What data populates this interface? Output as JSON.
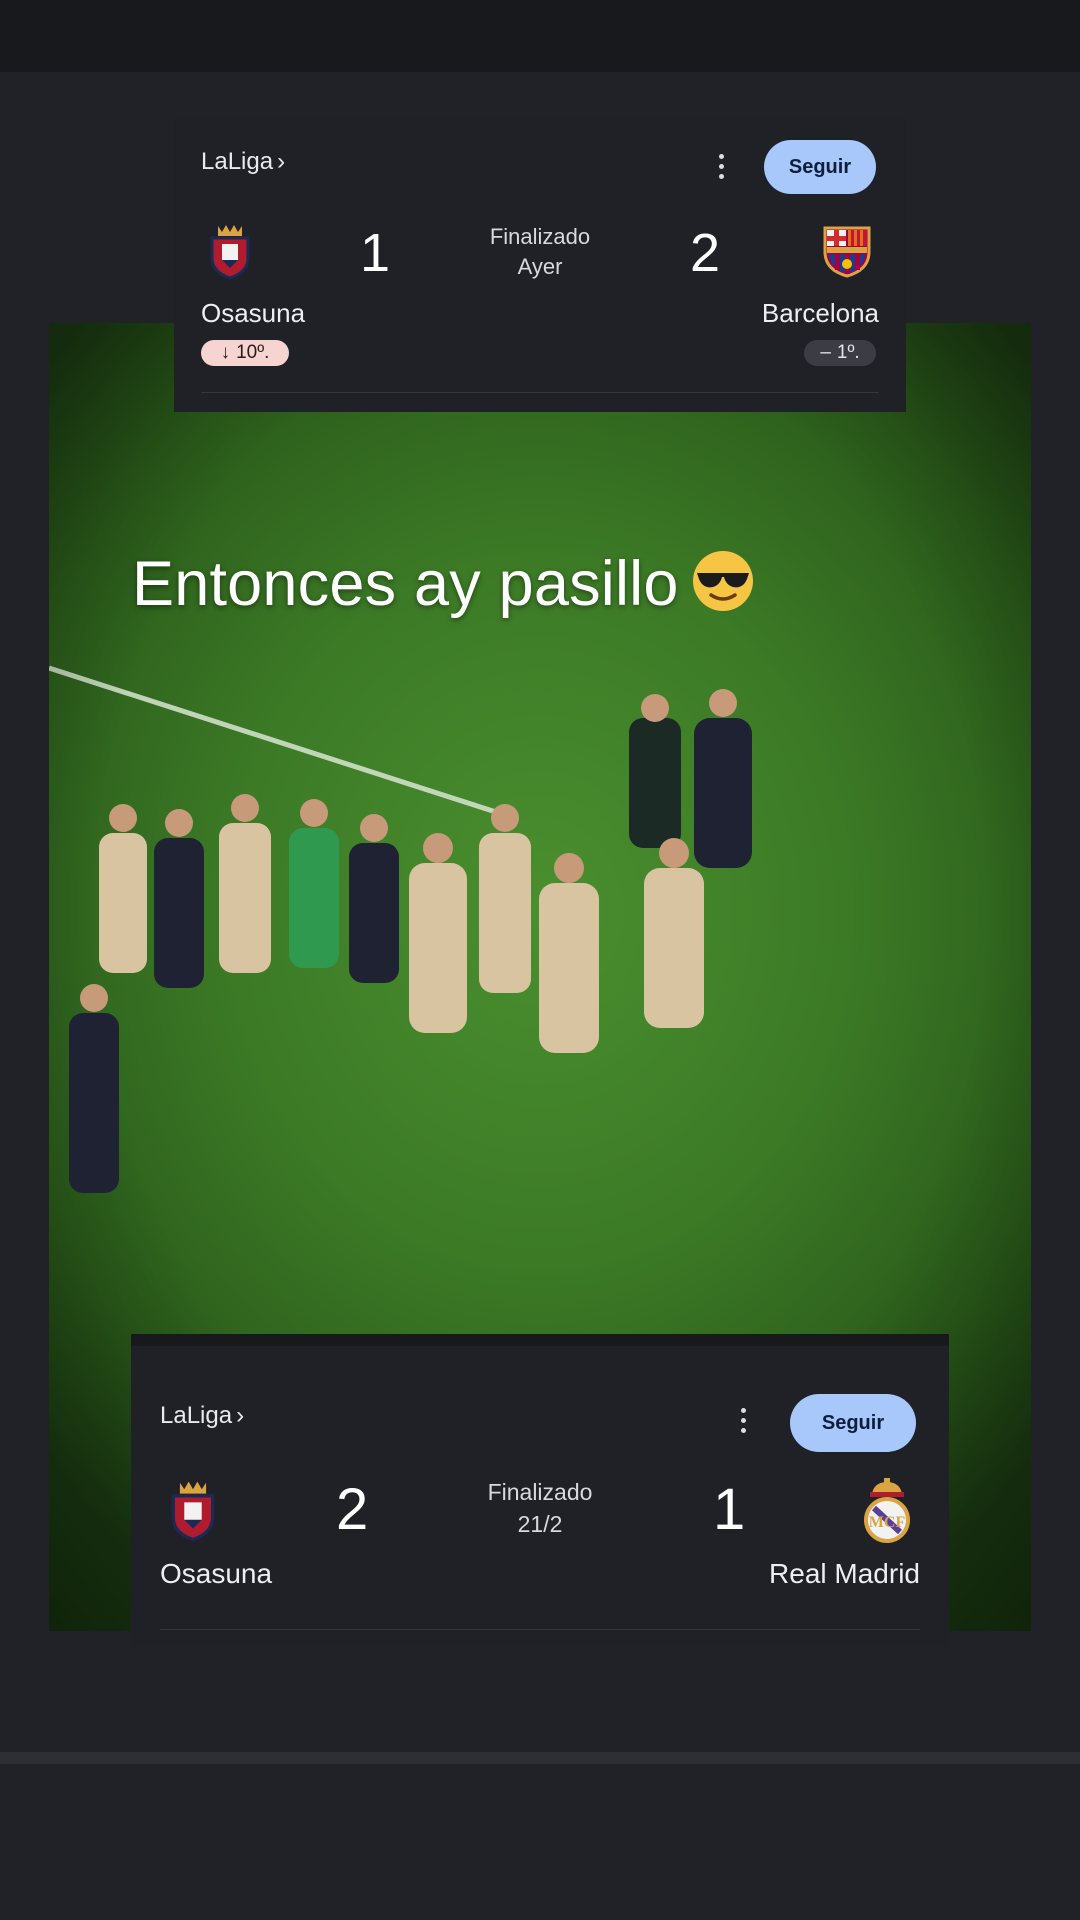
{
  "caption": {
    "text": "Entonces ay pasillo",
    "emoji": "sunglasses-emoji"
  },
  "match_top": {
    "league_label": "LaLiga",
    "league_chevron": "›",
    "follow_label": "Seguir",
    "status_line1": "Finalizado",
    "status_line2": "Ayer",
    "home": {
      "name": "Osasuna",
      "score": "1",
      "rank_label": "10º.",
      "rank_trend_icon": "↓",
      "crest": "osasuna-crest"
    },
    "away": {
      "name": "Barcelona",
      "score": "2",
      "rank_label": "1º.",
      "rank_trend_icon": "–",
      "crest": "barcelona-crest"
    }
  },
  "match_bottom": {
    "league_label": "LaLiga",
    "league_chevron": "›",
    "follow_label": "Seguir",
    "status_line1": "Finalizado",
    "status_line2": "21/2",
    "home": {
      "name": "Osasuna",
      "score": "2",
      "crest": "osasuna-crest"
    },
    "away": {
      "name": "Real Madrid",
      "score": "1",
      "crest": "real-madrid-crest"
    }
  },
  "colors": {
    "follow_button": "#a8c7fa",
    "card_bg": "#202127",
    "page_bg": "#212228",
    "rank_down_bg": "#f6d4d0"
  }
}
